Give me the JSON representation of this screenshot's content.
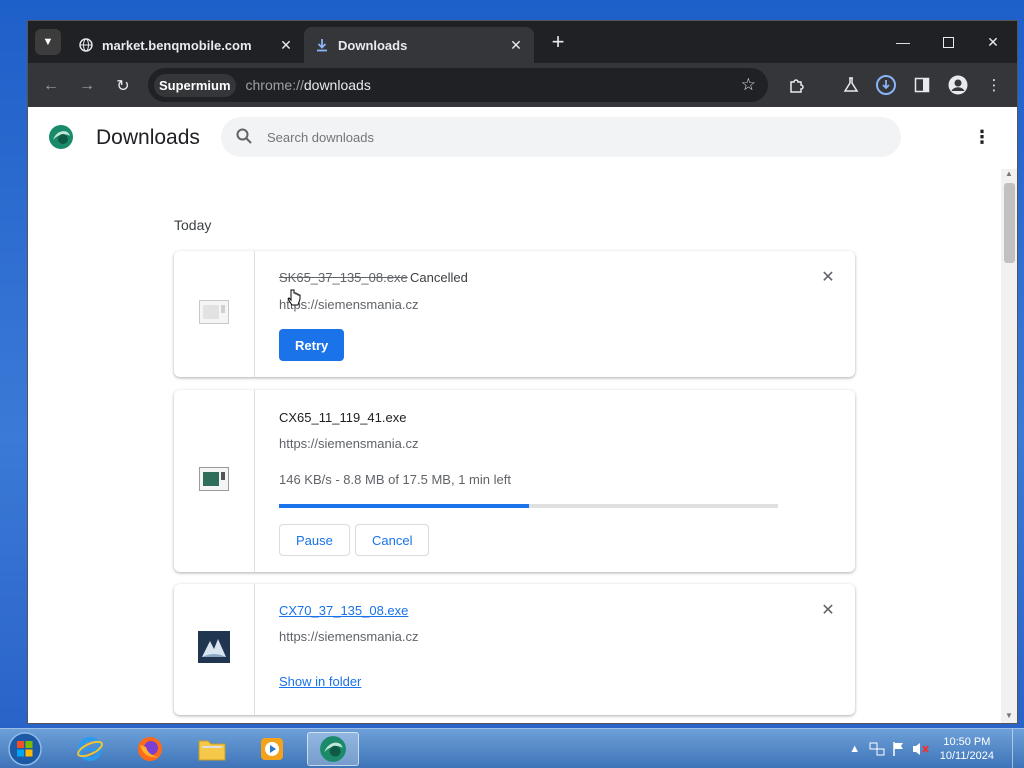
{
  "browser": {
    "tabs": [
      {
        "label": "market.benqmobile.com",
        "active": false
      },
      {
        "label": "Downloads",
        "active": true
      }
    ],
    "omnibox": {
      "chip": "Supermium",
      "url_scheme": "chrome://",
      "url_path": "downloads"
    }
  },
  "downloads_page": {
    "title": "Downloads",
    "search_placeholder": "Search downloads",
    "day_label": "Today",
    "items": [
      {
        "filename": "SK65_37_135_08.exe",
        "status": "Cancelled",
        "source": "https://siemensmania.cz",
        "action": "Retry"
      },
      {
        "filename": "CX65_11_119_41.exe",
        "source": "https://siemensmania.cz",
        "progress_text": "146 KB/s - 8.8 MB of 17.5 MB, 1 min left",
        "progress_fraction": 0.5,
        "actions": [
          "Pause",
          "Cancel"
        ]
      },
      {
        "filename": "CX70_37_135_08.exe",
        "source": "https://siemensmania.cz",
        "action": "Show in folder"
      }
    ]
  },
  "taskbar": {
    "apps": [
      "internet-explorer",
      "firefox",
      "file-explorer",
      "media-player",
      "supermium"
    ],
    "clock_time": "10:50 PM",
    "clock_date": "10/11/2024"
  },
  "colors": {
    "accent": "#1a73e8",
    "tabstrip": "#202124",
    "toolbar": "#35363a"
  }
}
